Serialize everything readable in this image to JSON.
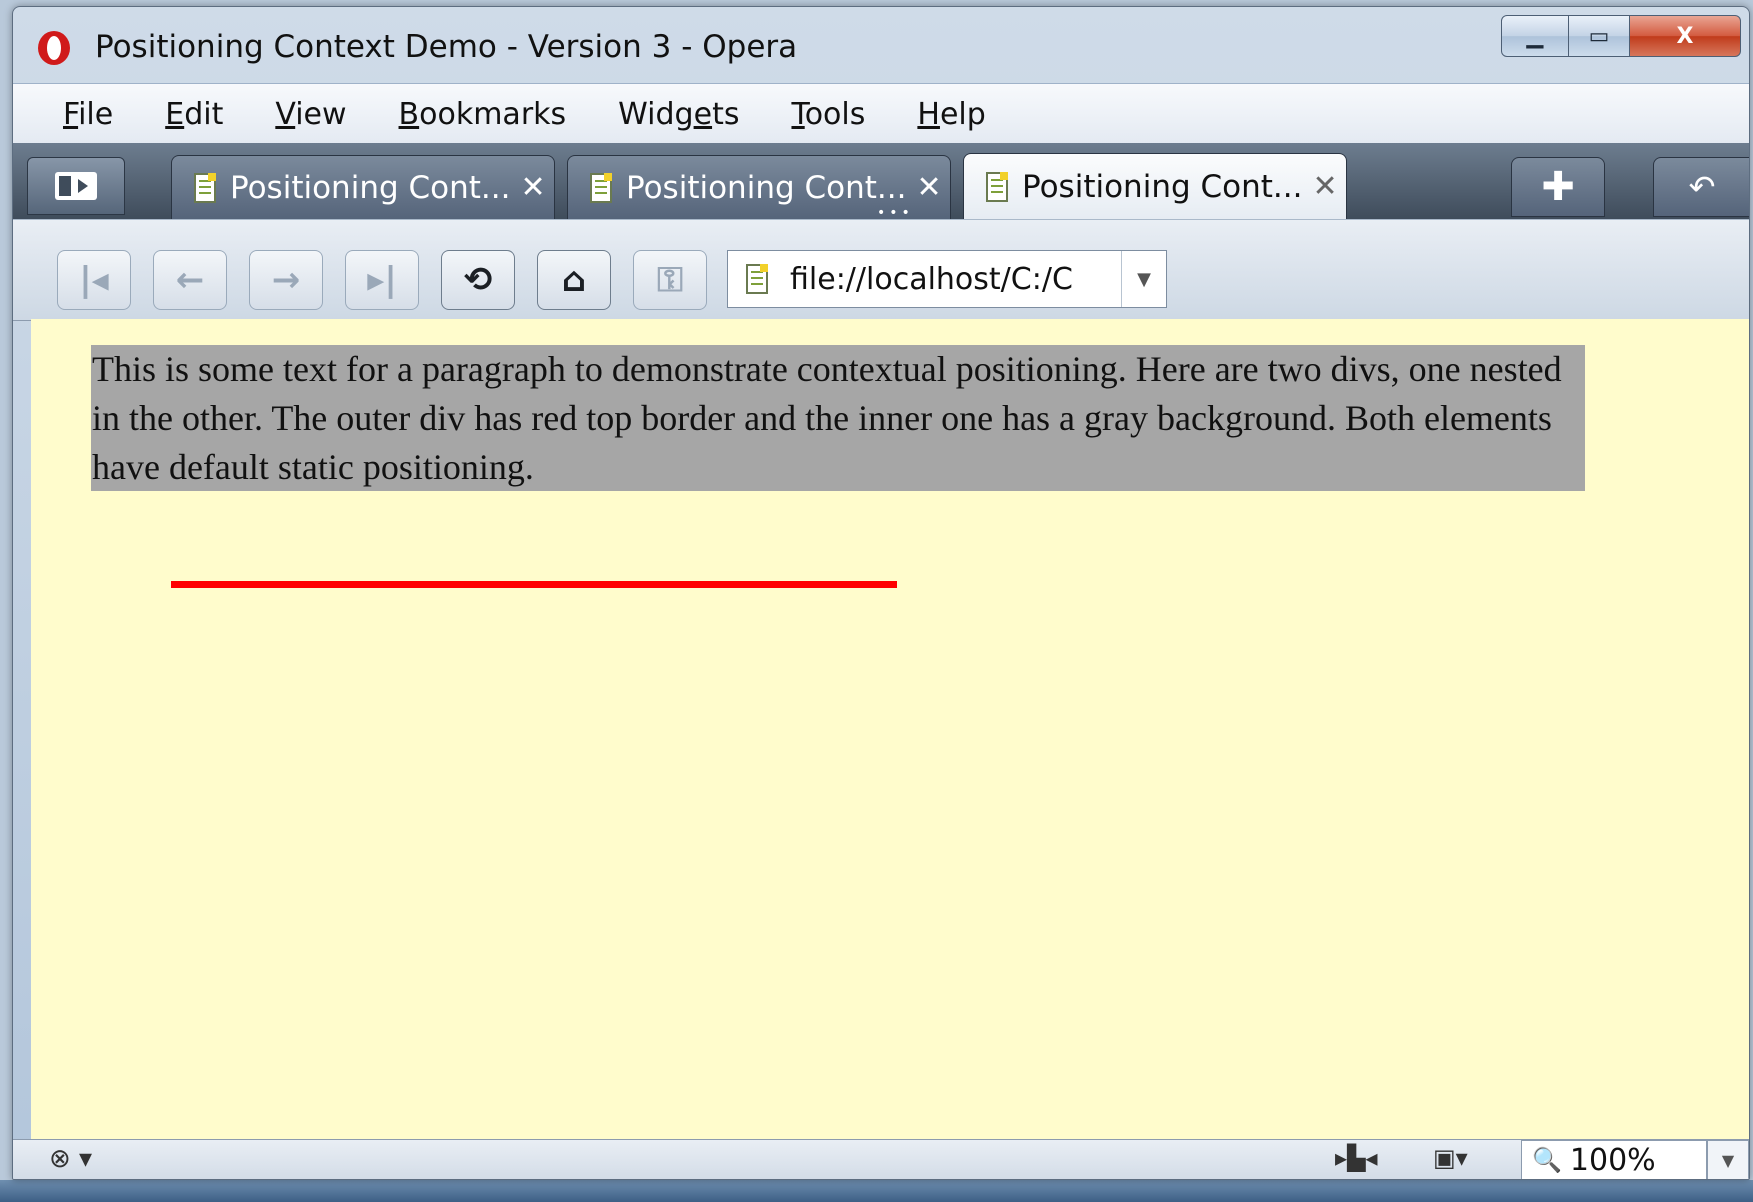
{
  "window": {
    "title": "Positioning Context Demo - Version 3 - Opera",
    "min_icon": "minimize-icon",
    "max_icon": "maximize-icon",
    "close_icon": "close-icon",
    "close_glyph": "X"
  },
  "menu": [
    {
      "key": "F",
      "rest": "ile"
    },
    {
      "key": "E",
      "rest": "dit"
    },
    {
      "key": "V",
      "rest": "iew"
    },
    {
      "key": "B",
      "rest": "ookmarks"
    },
    {
      "pre": "Widg",
      "key": "e",
      "rest": "ts"
    },
    {
      "key": "T",
      "rest": "ools"
    },
    {
      "key": "H",
      "rest": "elp"
    }
  ],
  "tabs": [
    {
      "label": "Positioning Cont...",
      "close": "✕",
      "active": false
    },
    {
      "label": "Positioning Cont...",
      "close": "✕",
      "active": false
    },
    {
      "label": "Positioning Cont...",
      "close": "✕",
      "active": true
    }
  ],
  "tabbar": {
    "new_tab_glyph": "✚",
    "trash_glyph": "↶"
  },
  "nav": {
    "buttons": [
      {
        "name": "rewind-button",
        "glyph": "|◂",
        "enabled": false
      },
      {
        "name": "back-button",
        "glyph": "←",
        "enabled": false
      },
      {
        "name": "forward-button",
        "glyph": "→",
        "enabled": false
      },
      {
        "name": "fast-forward-button",
        "glyph": "▸|",
        "enabled": false
      },
      {
        "name": "reload-button",
        "glyph": "⟲",
        "enabled": true
      },
      {
        "name": "home-button",
        "glyph": "⌂",
        "enabled": true
      },
      {
        "name": "security-button",
        "glyph": "⚿",
        "enabled": false
      }
    ],
    "address": "file://localhost/C:/C",
    "address_drop": "▼"
  },
  "content": {
    "paragraph": "This is some text for a paragraph to demonstrate contextual positioning. Here are two divs, one nested in the other. The outer div has red top border and the inner one has a gray background. Both elements have default static positioning.",
    "background": "#fffccc",
    "para_background": "#a6a6a6",
    "border_color": "#ff0000"
  },
  "status": {
    "zoom": "100%",
    "zoom_drop": "▼",
    "speed_dial_glyph": "⊗ ▾",
    "panel_glyph": "▸▙◂",
    "image_glyph": "▣▾",
    "zoom_glyph": "🔍"
  }
}
